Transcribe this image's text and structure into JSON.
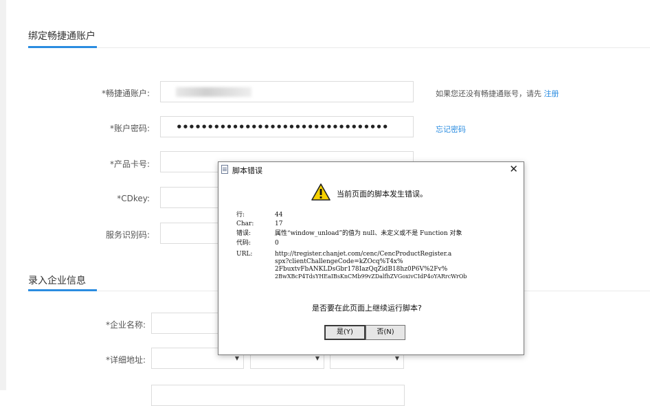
{
  "section1": {
    "title": "绑定畅捷通账户"
  },
  "section2": {
    "title": "录入企业信息"
  },
  "fields": {
    "account": {
      "label": "*畅捷通账户:",
      "hint_text": "如果您还没有畅捷通账号，请先",
      "hint_link": "注册"
    },
    "password": {
      "label": "*账户密码:",
      "value": "••••••••••••••••••••••••••••••••••",
      "link": "忘记密码"
    },
    "product_card": {
      "label": "*产品卡号:"
    },
    "cdkey": {
      "label": "*CDkey:"
    },
    "service_code": {
      "label": "服务识别码:"
    },
    "company_name": {
      "label": "*企业名称:"
    },
    "address": {
      "label": "*详细地址:"
    }
  },
  "dialog": {
    "title": "脚本错误",
    "close": "✕",
    "headline": "当前页面的脚本发生错误。",
    "details": [
      {
        "key": "行:",
        "value": "44"
      },
      {
        "key": "Char:",
        "value": "17"
      },
      {
        "key": "错误:",
        "value": "属性“window_unload”的值为 null、未定义或不是 Function 对象"
      },
      {
        "key": "代码:",
        "value": "0"
      },
      {
        "key": "URL:",
        "value": "http://tregister.chanjet.com/cenc/CencProductRegister.a"
      }
    ],
    "url_lines": [
      "spx?clientChallengeCode=kZOcq%T4x%",
      "2FbuxtvFbANKLDsGbr178IazQqZidB18hz0P6V%2Fv%",
      "2BwXBcP4TdsYHEaIBsKnCMb99vZDalfhZVGoxivCIdP4oYARrcWrOb"
    ],
    "question": "是否要在此页面上继续运行脚本?",
    "yes": "是(Y)",
    "no": "否(N)"
  },
  "colors": {
    "accent": "#2a8ce0",
    "required": "#e23b3b"
  },
  "icons": {
    "warning": "warning-icon",
    "document": "document-icon",
    "close": "close-icon"
  }
}
